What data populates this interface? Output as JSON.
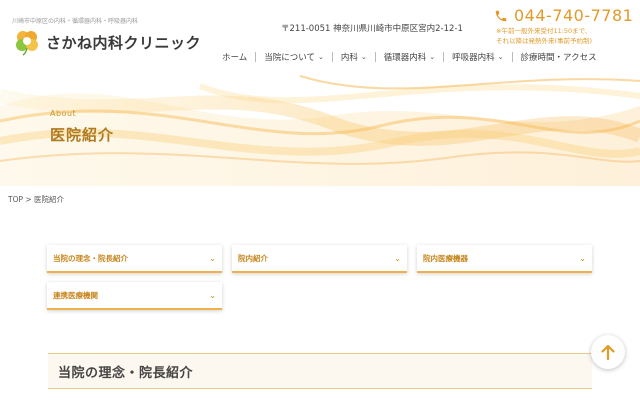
{
  "header": {
    "tagline": "川崎市中原区の内科・循環器内科・呼吸器内科",
    "logo_text": "さかね内科クリニック",
    "address": "〒211-0051 神奈川県川崎市中原区宮内2-12-1",
    "phone": "044-740-7781",
    "hours_line1": "※午前一般外来受付11:50まで、",
    "hours_line2": "それ以降は発熱外来(事前予約制)",
    "icons": {
      "logo": "clover-logo-icon",
      "phone": "phone-icon"
    },
    "accent_color": "#e49a2a"
  },
  "nav": {
    "items": [
      {
        "label": "ホーム",
        "dropdown": false
      },
      {
        "label": "当院について",
        "dropdown": true
      },
      {
        "label": "内科",
        "dropdown": true
      },
      {
        "label": "循環器内科",
        "dropdown": true
      },
      {
        "label": "呼吸器内科",
        "dropdown": true
      },
      {
        "label": "診療時間・アクセス",
        "dropdown": false
      }
    ]
  },
  "hero": {
    "subtitle": "About",
    "title": "医院紹介"
  },
  "breadcrumb": "TOP > 医院紹介",
  "anchors": [
    {
      "label": "当院の理念・院長紹介"
    },
    {
      "label": "院内紹介"
    },
    {
      "label": "院内医療機器"
    },
    {
      "label": "連携医療機関"
    }
  ],
  "section": {
    "title": "当院の理念・院長紹介"
  },
  "back_to_top": {
    "icon": "arrow-up-icon"
  }
}
